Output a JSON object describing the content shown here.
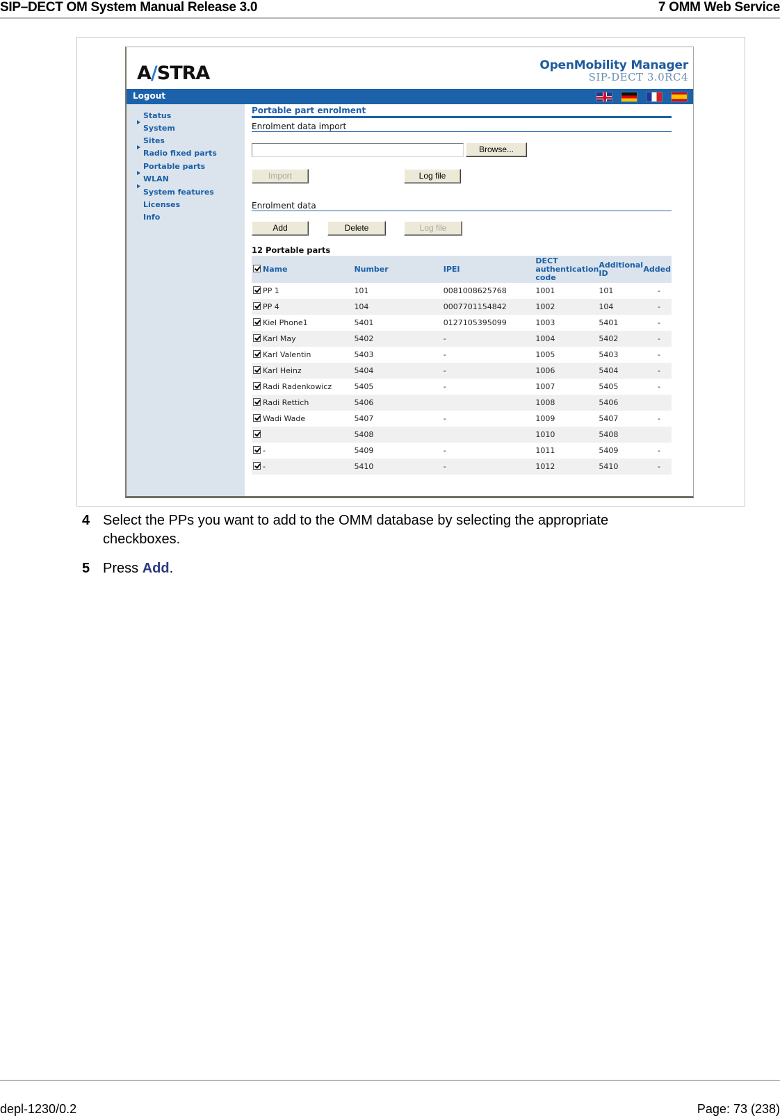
{
  "document": {
    "header_left": "SIP–DECT OM System Manual Release 3.0",
    "header_right": "7 OMM Web Service",
    "footer_left": "depl-1230/0.2",
    "footer_right": "Page: 73 (238)"
  },
  "app": {
    "logo": {
      "part1": "A",
      "part2": "/",
      "part3": "STRA"
    },
    "product_name": "OpenMobility Manager",
    "product_version": "SIP-DECT 3.0RC4",
    "logout_label": "Logout",
    "flags": [
      {
        "name": "english",
        "icon": "flag-uk-icon"
      },
      {
        "name": "german",
        "icon": "flag-de-icon"
      },
      {
        "name": "french",
        "icon": "flag-fr-icon"
      },
      {
        "name": "spanish",
        "icon": "flag-es-icon"
      }
    ],
    "sidebar": {
      "items": [
        {
          "label": "Status",
          "expandable": false
        },
        {
          "label": "System",
          "expandable": true
        },
        {
          "label": "Sites",
          "expandable": false
        },
        {
          "label": "Radio fixed parts",
          "expandable": true
        },
        {
          "label": "Portable parts",
          "expandable": false
        },
        {
          "label": "WLAN",
          "expandable": true
        },
        {
          "label": "System features",
          "expandable": true
        },
        {
          "label": "Licenses",
          "expandable": false
        },
        {
          "label": "Info",
          "expandable": false
        }
      ]
    },
    "main": {
      "page_title": "Portable part enrolment",
      "import_section": {
        "title": "Enrolment data import",
        "file_value": "",
        "browse_label": "Browse...",
        "import_label": "Import",
        "import_disabled": true,
        "logfile_label": "Log file",
        "logfile_disabled": false
      },
      "data_section": {
        "title": "Enrolment data",
        "add_label": "Add",
        "delete_label": "Delete",
        "logfile_label": "Log file",
        "logfile_disabled": true
      },
      "table": {
        "count_title": "12 Portable parts",
        "select_all_checked": true,
        "columns": {
          "name": "Name",
          "number": "Number",
          "ipei": "IPEI",
          "auth_line1": "DECT",
          "auth_line2": "authentication",
          "auth_line3": "code",
          "addid_line1": "Additional",
          "addid_line2": "ID",
          "added": "Added"
        },
        "rows": [
          {
            "checked": true,
            "name": "PP 1",
            "number": "101",
            "ipei": "0081008625768",
            "auth": "1001",
            "addid": "101",
            "added": "-"
          },
          {
            "checked": true,
            "name": "PP 4",
            "number": "104",
            "ipei": "0007701154842",
            "auth": "1002",
            "addid": "104",
            "added": "-"
          },
          {
            "checked": true,
            "name": "Kiel Phone1",
            "number": "5401",
            "ipei": "0127105395099",
            "auth": "1003",
            "addid": "5401",
            "added": "-"
          },
          {
            "checked": true,
            "name": "Karl May",
            "number": "5402",
            "ipei": "-",
            "auth": "1004",
            "addid": "5402",
            "added": "-"
          },
          {
            "checked": true,
            "name": "Karl Valentin",
            "number": "5403",
            "ipei": "-",
            "auth": "1005",
            "addid": "5403",
            "added": "-"
          },
          {
            "checked": true,
            "name": "Karl Heinz",
            "number": "5404",
            "ipei": "-",
            "auth": "1006",
            "addid": "5404",
            "added": "-"
          },
          {
            "checked": true,
            "name": "Radi Radenkowicz",
            "number": "5405",
            "ipei": "-",
            "auth": "1007",
            "addid": "5405",
            "added": "-"
          },
          {
            "checked": true,
            "name": "Radi Rettich",
            "number": "5406",
            "ipei": "",
            "auth": "1008",
            "addid": "5406",
            "added": ""
          },
          {
            "checked": true,
            "name": "Wadi Wade",
            "number": "5407",
            "ipei": "-",
            "auth": "1009",
            "addid": "5407",
            "added": "-"
          },
          {
            "checked": true,
            "name": "",
            "number": "5408",
            "ipei": "",
            "auth": "1010",
            "addid": "5408",
            "added": ""
          },
          {
            "checked": true,
            "name": "-",
            "number": "5409",
            "ipei": "-",
            "auth": "1011",
            "addid": "5409",
            "added": "-"
          },
          {
            "checked": true,
            "name": "-",
            "number": "5410",
            "ipei": "-",
            "auth": "1012",
            "addid": "5410",
            "added": "-"
          }
        ]
      }
    }
  },
  "steps": [
    {
      "num": "4",
      "text_line1": "Select the PPs you want to add to the OMM database by selecting the appropriate",
      "text_line2": "checkboxes."
    },
    {
      "num": "5",
      "text_before": "Press ",
      "keyword": "Add",
      "text_after": "."
    }
  ]
}
